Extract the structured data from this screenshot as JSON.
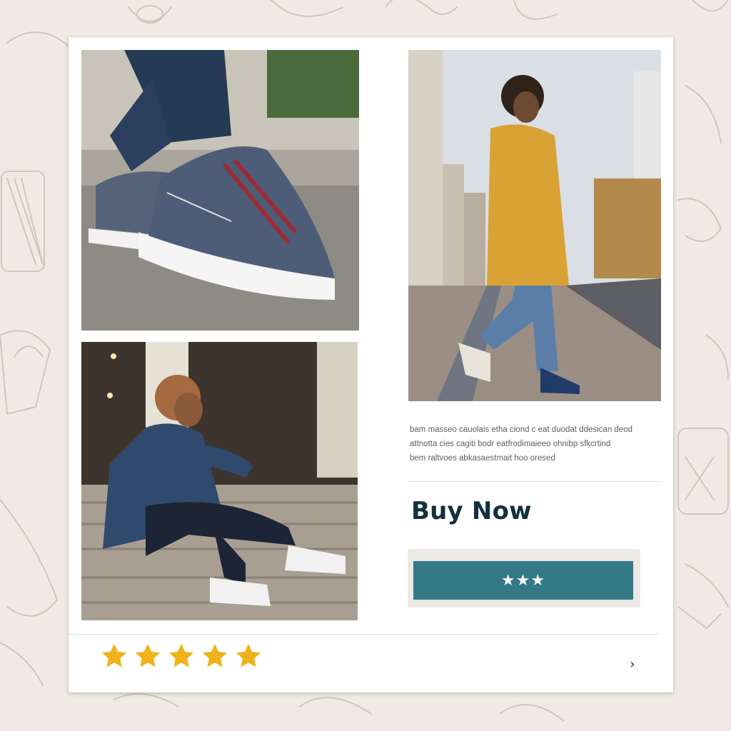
{
  "product": {
    "description_lines": [
      "bam masseo cauolais etha ciond c eat duodat ddesican deod",
      "attnotta cies cagiti bodr eatfrodimaieeo ohnibp sfkcrtind",
      "bem raltvoes abkasaestmait hoo oresed"
    ],
    "buy_title": "Buy Now",
    "cta_label": "★★★"
  },
  "rating": {
    "value": 5,
    "max": 5,
    "star_color": "#f0b21a"
  },
  "navigation": {
    "next_icon": "arrow-right-icon",
    "next_glyph": "›"
  },
  "colors": {
    "background": "#efebe4",
    "card": "#ffffff",
    "accent": "#337988",
    "title": "#14303f",
    "cta_frame": "#ece9e4"
  },
  "images": [
    {
      "name": "sneaker-closeup-photo",
      "subject": "denim platform sneaker with red laces"
    },
    {
      "name": "woman-sitting-steps-photo",
      "subject": "woman in denim jacket wearing white sneakers"
    },
    {
      "name": "woman-walking-street-photo",
      "subject": "woman in yellow coat walking on city street"
    }
  ]
}
